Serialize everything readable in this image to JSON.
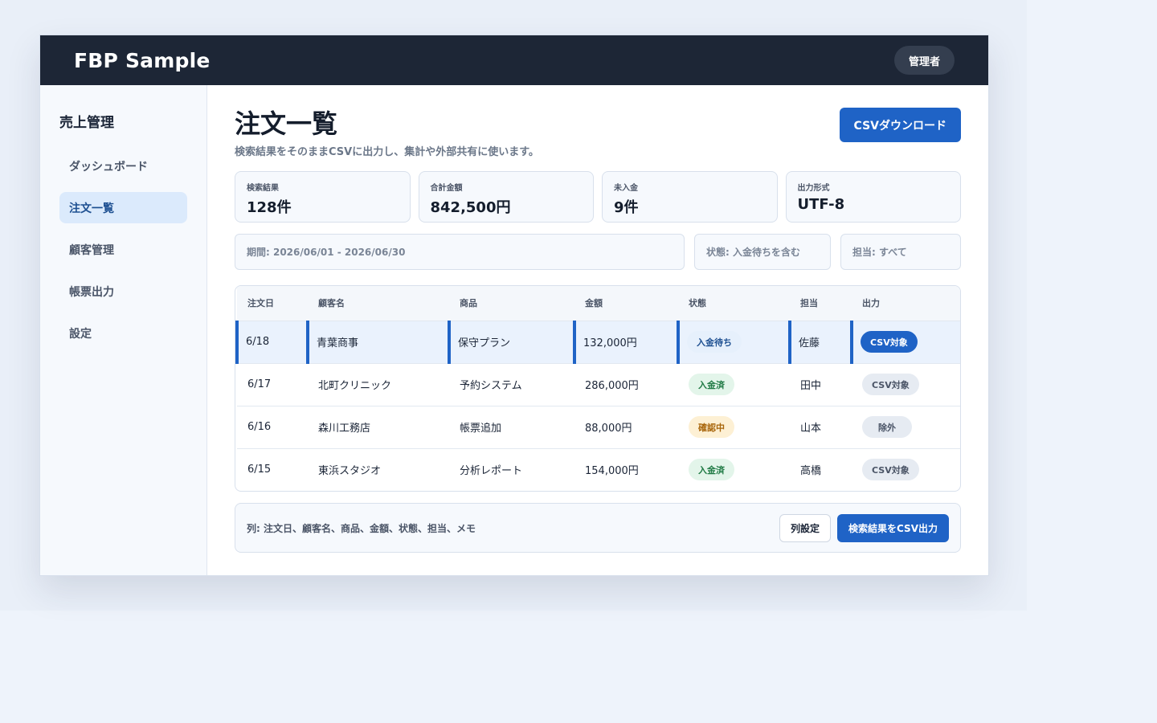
{
  "app": {
    "brand": "FBP Sample",
    "user_label": "管理者"
  },
  "sidebar": {
    "title": "売上管理",
    "items": [
      {
        "label": "ダッシュボード",
        "active": false
      },
      {
        "label": "注文一覧",
        "active": true
      },
      {
        "label": "顧客管理",
        "active": false
      },
      {
        "label": "帳票出力",
        "active": false
      },
      {
        "label": "設定",
        "active": false
      }
    ]
  },
  "page": {
    "title": "注文一覧",
    "description": "検索結果をそのままCSVに出力し、集計や外部共有に使います。",
    "download_label": "CSVダウンロード"
  },
  "stats": [
    {
      "label": "検索結果",
      "value": "128件"
    },
    {
      "label": "合計金額",
      "value": "842,500円"
    },
    {
      "label": "未入金",
      "value": "9件"
    },
    {
      "label": "出力形式",
      "value": "UTF-8"
    }
  ],
  "filters": {
    "period": "期間: 2026/06/01 - 2026/06/30",
    "status": "状態: 入金待ちを含む",
    "owner": "担当: すべて"
  },
  "table": {
    "columns": [
      "注文日",
      "顧客名",
      "商品",
      "金額",
      "状態",
      "担当",
      "出力"
    ],
    "rows": [
      {
        "date": "6/18",
        "customer": "青葉商事",
        "product": "保守プラン",
        "amount": "132,000円",
        "status": "入金待ち",
        "status_type": "pending",
        "owner": "佐藤",
        "output": "CSV対象",
        "output_type": "csv-on",
        "selected": true
      },
      {
        "date": "6/17",
        "customer": "北町クリニック",
        "product": "予約システム",
        "amount": "286,000円",
        "status": "入金済",
        "status_type": "paid",
        "owner": "田中",
        "output": "CSV対象",
        "output_type": "csv-off",
        "selected": false
      },
      {
        "date": "6/16",
        "customer": "森川工務店",
        "product": "帳票追加",
        "amount": "88,000円",
        "status": "確認中",
        "status_type": "checking",
        "owner": "山本",
        "output": "除外",
        "output_type": "excluded",
        "selected": false
      },
      {
        "date": "6/15",
        "customer": "東浜スタジオ",
        "product": "分析レポート",
        "amount": "154,000円",
        "status": "入金済",
        "status_type": "paid",
        "owner": "高橋",
        "output": "CSV対象",
        "output_type": "csv-off",
        "selected": false
      }
    ]
  },
  "footer": {
    "columns_note": "列: 注文日、顧客名、商品、金額、状態、担当、メモ",
    "column_settings_label": "列設定",
    "export_label": "検索結果をCSV出力"
  },
  "colors": {
    "topbar": "#1d2636",
    "accent": "#1f63c6",
    "paid": "#1f7a44",
    "checking": "#a8650a"
  }
}
